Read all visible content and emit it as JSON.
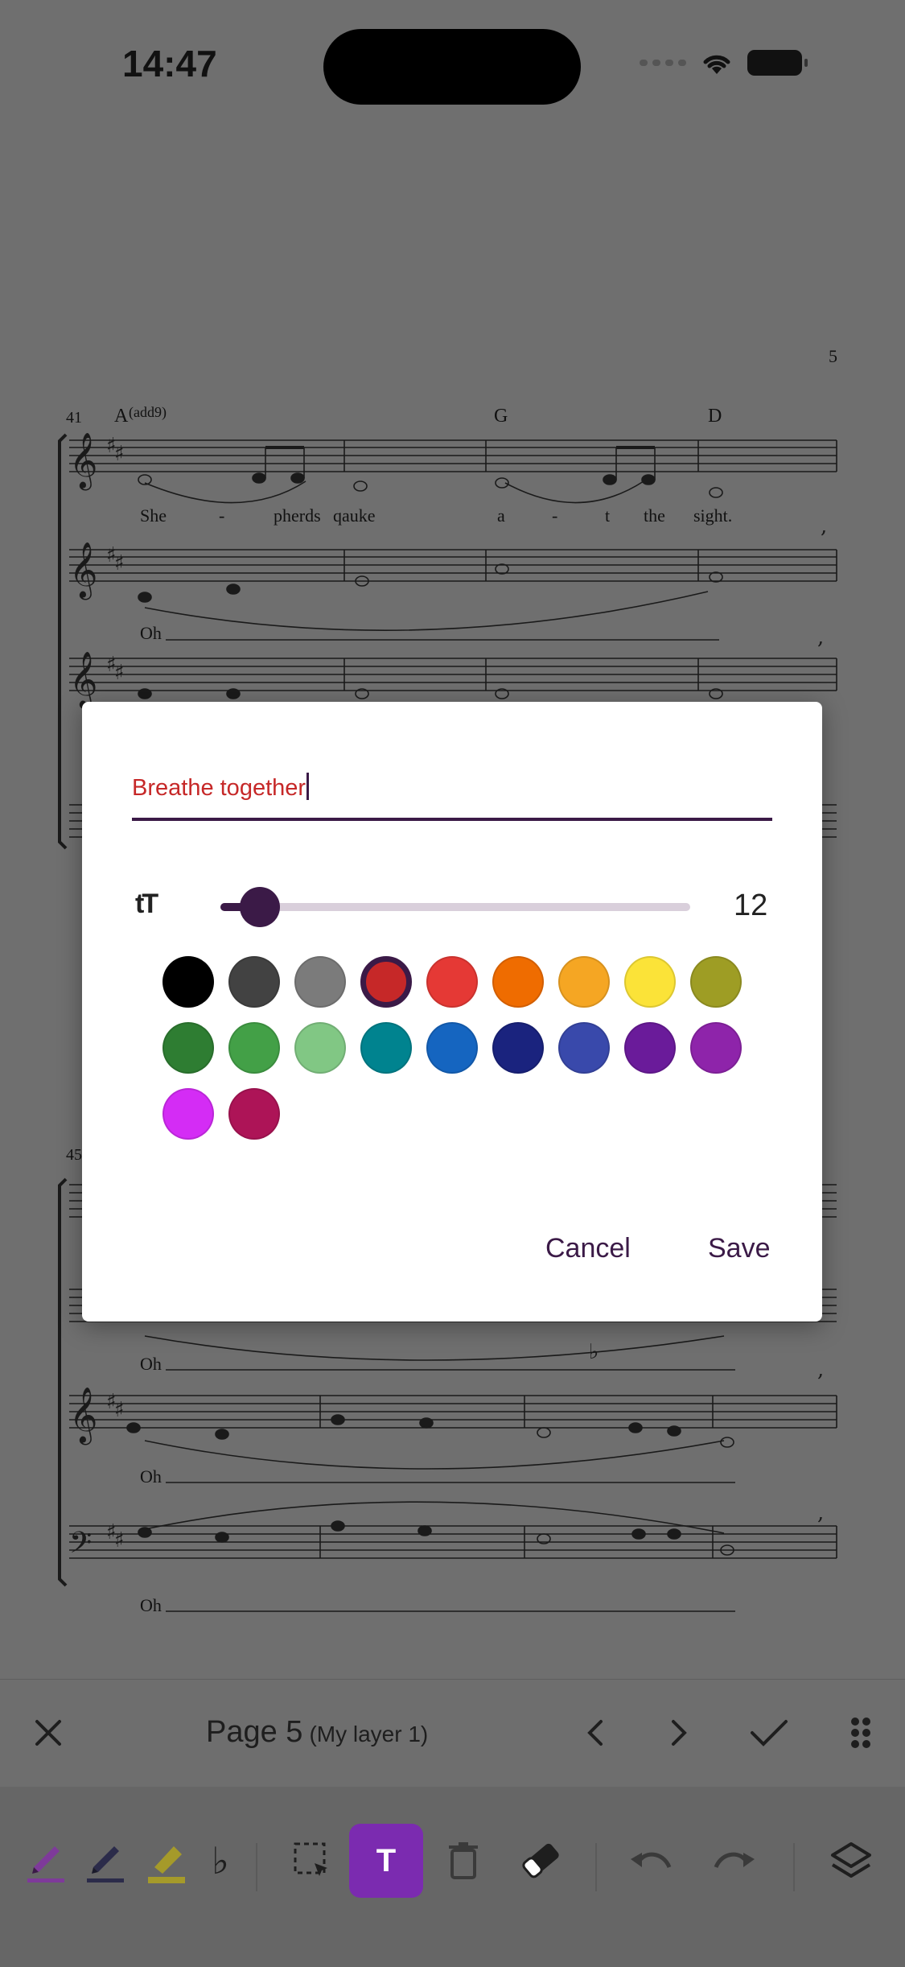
{
  "status_bar": {
    "time": "14:47"
  },
  "score": {
    "page_number": "5",
    "system1": {
      "measure_number": "41",
      "chords": [
        "A",
        "(add9)",
        "G",
        "D"
      ],
      "lyrics_v1": [
        "She",
        "-",
        "pherds",
        "qauke",
        "a",
        "-",
        "t",
        "the",
        "sight."
      ],
      "lyrics_v2": "Oh"
    },
    "system2": {
      "measure_number": "45",
      "lyrics": [
        "Oh",
        "Oh",
        "Oh"
      ]
    }
  },
  "dialog": {
    "text_value": "Breathe together",
    "font_size_icon": "tT",
    "font_size_value": "12",
    "font_size_level": 12,
    "colors": [
      "#000000",
      "#424242",
      "#7b7b7b",
      "#c62828",
      "#e53935",
      "#ef6c00",
      "#f5a623",
      "#fbe338",
      "#9e9d24",
      "#2e7d32",
      "#43a047",
      "#81c784",
      "#00838f",
      "#1565c0",
      "#1a237e",
      "#3949ab",
      "#6a1b9a",
      "#8e24aa",
      "#d42cf5",
      "#ad1457"
    ],
    "selected_color_index": 3,
    "cancel_label": "Cancel",
    "save_label": "Save"
  },
  "nav_bar": {
    "page_label": "Page 5",
    "layer_label": "(My layer 1)"
  },
  "tool_bar": {
    "tools": [
      "pen-purple",
      "pen-dark",
      "highlighter-yellow",
      "flat-symbol",
      "select",
      "text",
      "delete",
      "eraser",
      "undo",
      "redo",
      "layers"
    ],
    "flat_glyph": "♭",
    "text_tool_label": "T",
    "active_tool": "text"
  }
}
